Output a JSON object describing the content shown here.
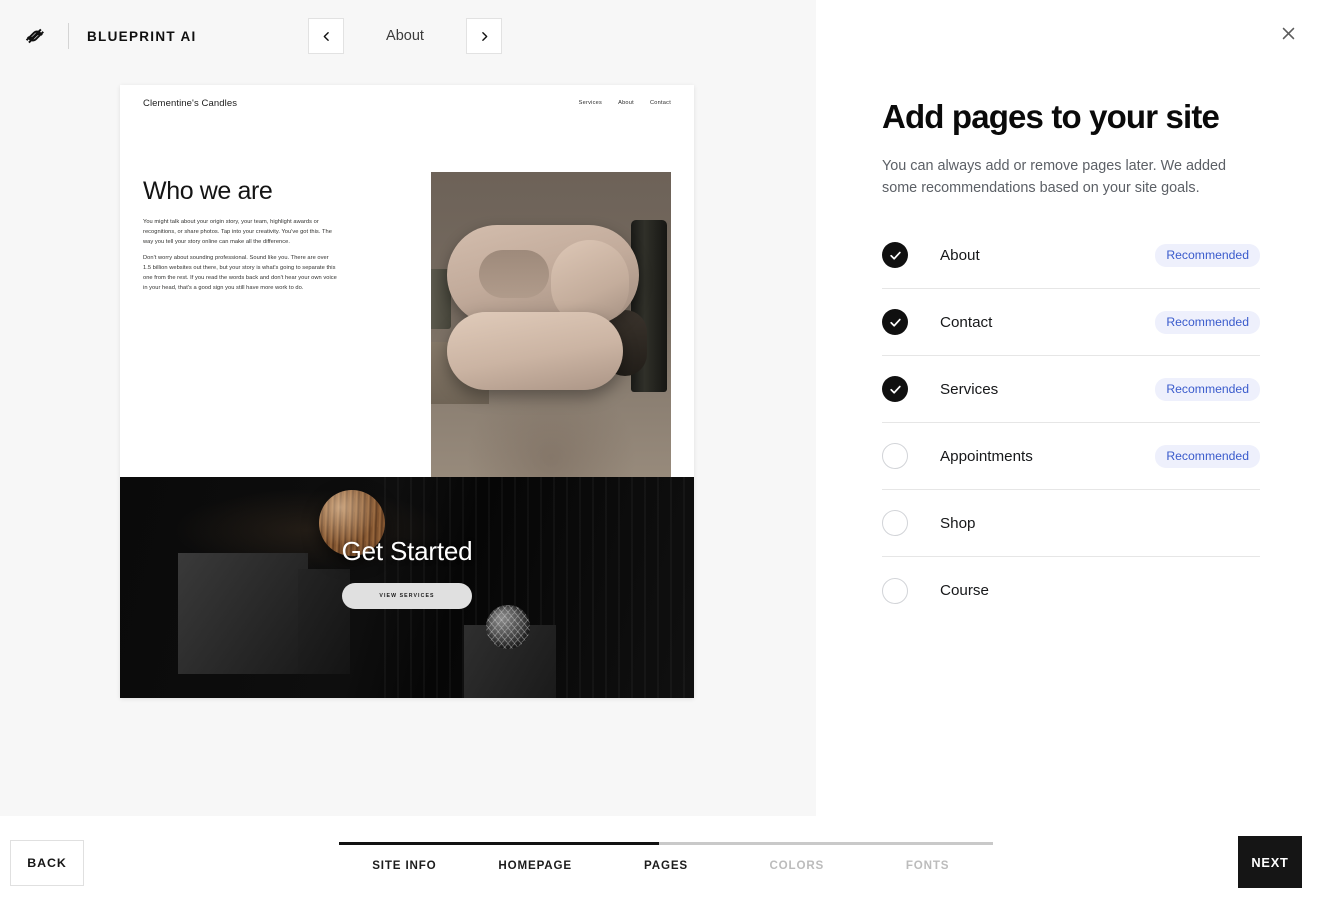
{
  "header": {
    "logo_icon": "squarespace-logo-icon",
    "brand_name": "BLUEPRINT AI",
    "prev_icon": "chevron-left-icon",
    "next_icon": "chevron-right-icon",
    "current_page": "About"
  },
  "preview": {
    "site_name": "Clementine's Candles",
    "nav": [
      "Services",
      "About",
      "Contact"
    ],
    "about": {
      "heading": "Who we are",
      "paragraphs": [
        "You might talk about your origin story, your team, highlight awards or recognitions, or share photos. Tap into your creativity. You've got this. The way you tell your story online can make all the difference.",
        "Don't worry about sounding professional. Sound like you. There are over 1.5 billion websites out there, but your story is what's going to separate this one from the rest. If you read the words back and don't hear your own voice in your head, that's a good sign you still have more work to do."
      ]
    },
    "hero": {
      "title": "Get Started",
      "cta_label": "VIEW SERVICES"
    }
  },
  "panel": {
    "close_icon": "close-icon",
    "title": "Add pages to your site",
    "subtitle": "You can always add or remove pages later. We added some recommendations based on your site goals.",
    "badge_color": "#3a5bcc",
    "badge_bg": "#eef0fc",
    "pages": [
      {
        "label": "About",
        "selected": true,
        "badge": "Recommended"
      },
      {
        "label": "Contact",
        "selected": true,
        "badge": "Recommended"
      },
      {
        "label": "Services",
        "selected": true,
        "badge": "Recommended"
      },
      {
        "label": "Appointments",
        "selected": false,
        "badge": "Recommended"
      },
      {
        "label": "Shop",
        "selected": false,
        "badge": ""
      },
      {
        "label": "Course",
        "selected": false,
        "badge": ""
      }
    ]
  },
  "footer": {
    "back_label": "BACK",
    "next_label": "NEXT",
    "steps": [
      "SITE INFO",
      "HOMEPAGE",
      "PAGES",
      "COLORS",
      "FONTS"
    ],
    "active_step_index": 2,
    "progress_percent": 49
  }
}
